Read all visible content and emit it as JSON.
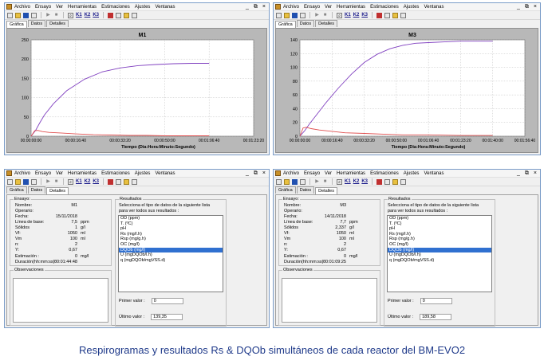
{
  "menu": [
    "Archivo",
    "Ensayo",
    "Ver",
    "Herramientas",
    "Estimaciones",
    "Ajustes",
    "Ventanas"
  ],
  "window_controls": [
    "_",
    "⧉",
    "×"
  ],
  "toolbar_buttons": [
    "new-icon",
    "open-icon",
    "save-icon",
    "tools-icon",
    "play-icon",
    "stop-icon",
    "zoom-icon",
    "K1",
    "K2",
    "K3",
    "list-icon",
    "chart-icon",
    "image-icon"
  ],
  "k_labels": [
    "K1",
    "K2",
    "K3"
  ],
  "tabs": [
    "Gráfica",
    "Datos",
    "Detalles"
  ],
  "chart_data": [
    {
      "type": "line",
      "title": "M1",
      "xlabel": "Tiempo (Dia:Hora:Minuto:Segundo)",
      "ylabel": "",
      "x_ticks": [
        "00:00:00:00",
        "00:00:16:40",
        "00:00:33:20",
        "00:00:50:00",
        "00:01:06:40",
        "00:01:23:20"
      ],
      "xlim": [
        0,
        5000
      ],
      "ylim": [
        0,
        250
      ],
      "y_ticks": [
        0,
        50,
        100,
        150,
        200,
        250
      ],
      "grid": true,
      "series": [
        {
          "color": "#8040c0",
          "x": [
            0,
            100,
            200,
            300,
            500,
            800,
            1200,
            1600,
            2000,
            2400,
            2800,
            3200,
            3600,
            4000
          ],
          "y": [
            0,
            15,
            36,
            55,
            84,
            118,
            148,
            167,
            177,
            183,
            186,
            188,
            189,
            189
          ]
        },
        {
          "color": "#e05050",
          "x": [
            0,
            80,
            150,
            250,
            400,
            700,
            1000,
            1400,
            1800,
            2200,
            2600,
            3000,
            3400,
            4000
          ],
          "y": [
            0,
            14,
            15,
            12,
            10,
            8,
            6,
            4,
            3,
            2,
            2,
            1,
            1,
            1
          ]
        }
      ]
    },
    {
      "type": "line",
      "title": "M3",
      "xlabel": "Tiempo (Dia:Hora:Minuto:Segundo)",
      "ylabel": "",
      "x_ticks": [
        "00:00:00:00",
        "00:00:16:40",
        "00:00:33:20",
        "00:00:50:00",
        "00:01:06:40",
        "00:01:23:20",
        "00:01:40:00",
        "00:01:56:40"
      ],
      "xlim": [
        0,
        7000
      ],
      "ylim": [
        0,
        140
      ],
      "y_ticks": [
        0,
        20,
        40,
        60,
        80,
        100,
        120,
        140
      ],
      "grid": true,
      "series": [
        {
          "color": "#8040c0",
          "x": [
            0,
            150,
            300,
            500,
            800,
            1200,
            1600,
            2000,
            2400,
            2800,
            3200,
            3600,
            4000,
            4500,
            5000,
            5500,
            6000
          ],
          "y": [
            0,
            8,
            18,
            30,
            48,
            70,
            90,
            107,
            119,
            127,
            132,
            135,
            136,
            137,
            138,
            138,
            138
          ]
        },
        {
          "color": "#e05050",
          "x": [
            0,
            100,
            200,
            350,
            600,
            1000,
            1400,
            2000,
            2600,
            3200,
            4000,
            5000,
            6000
          ],
          "y": [
            0,
            12,
            13,
            11,
            9,
            7,
            5,
            4,
            3,
            2,
            2,
            1,
            1
          ]
        }
      ]
    }
  ],
  "details": [
    {
      "section_title": "Ensayo:",
      "rows": [
        {
          "label": "Nombre:",
          "value": "M1",
          "unit": ""
        },
        {
          "label": "Operario:",
          "value": "",
          "unit": ""
        },
        {
          "label": "Fecha:",
          "value": "15/11/2018",
          "unit": ""
        },
        {
          "label": "Línea de base:",
          "value": "7,5",
          "unit": "ppm"
        },
        {
          "label": "Sólidos",
          "value": "1",
          "unit": "g/l"
        },
        {
          "label": "Vf:",
          "value": "1050",
          "unit": "ml"
        },
        {
          "label": "Vm",
          "value": "100",
          "unit": "ml"
        },
        {
          "label": "n:",
          "value": "2",
          "unit": ""
        },
        {
          "label": "Y:",
          "value": "0,67",
          "unit": ""
        },
        {
          "label": "Estimación :",
          "value": "0",
          "unit": "mg/l"
        },
        {
          "label": "Duración(hh:mm:ss):",
          "value": "00:01:44:48",
          "unit": ""
        }
      ],
      "results_title": "Resultados",
      "results_text": "Selecciona el tipo de datos de la siguiente lista para ver todos sus resultados :",
      "results_list": [
        "OD (ppm)",
        "T. (ºC)",
        "pH",
        "Rs (mg/l.h)",
        "Rsp (mg/g.h)",
        "OC (mg/l)",
        "DQOb (mg/l)",
        "U (mgDQOb/l.h)",
        "q (mgDQOb/mgVSS.d)"
      ],
      "selected_index": 6,
      "observations_label": "Observaciones",
      "primer_label": "Primer valor :",
      "primer_value": "0",
      "ultimo_label": "Último valor :",
      "ultimo_value": "139,35"
    },
    {
      "section_title": "Ensayo:",
      "rows": [
        {
          "label": "Nombre:",
          "value": "M3",
          "unit": ""
        },
        {
          "label": "Operario:",
          "value": "",
          "unit": ""
        },
        {
          "label": "Fecha:",
          "value": "14/11/2018",
          "unit": ""
        },
        {
          "label": "Línea de base:",
          "value": "7,7",
          "unit": "ppm"
        },
        {
          "label": "Sólidos",
          "value": "2,337",
          "unit": "g/l"
        },
        {
          "label": "Vf:",
          "value": "1050",
          "unit": "ml"
        },
        {
          "label": "Vm",
          "value": "100",
          "unit": "ml"
        },
        {
          "label": "n:",
          "value": "2",
          "unit": ""
        },
        {
          "label": "Y:",
          "value": "0,67",
          "unit": ""
        },
        {
          "label": "Estimación :",
          "value": "0",
          "unit": "mg/l"
        },
        {
          "label": "Duración(hh:mm:ss):",
          "value": "00:01:09:25",
          "unit": ""
        }
      ],
      "results_title": "Resultados",
      "results_text": "Selecciona el tipo de datos de la siguiente lista para ver todos sus resultados :",
      "results_list": [
        "OD (ppm)",
        "T. (ºC)",
        "pH",
        "Rs (mg/l.h)",
        "Rsp (mg/g.h)",
        "OC (mg/l)",
        "DQOb (mg/l)",
        "U (mgDQOb/l.h)",
        "q (mgDQOb/mgVSS.d)"
      ],
      "selected_index": 6,
      "observations_label": "Observaciones",
      "primer_label": "Primer valor :",
      "primer_value": "0",
      "ultimo_label": "Último valor :",
      "ultimo_value": "189,58"
    }
  ],
  "caption": "Respirogramas y resultados Rs & DQOb simultáneos de cada reactor del BM-EVO2"
}
